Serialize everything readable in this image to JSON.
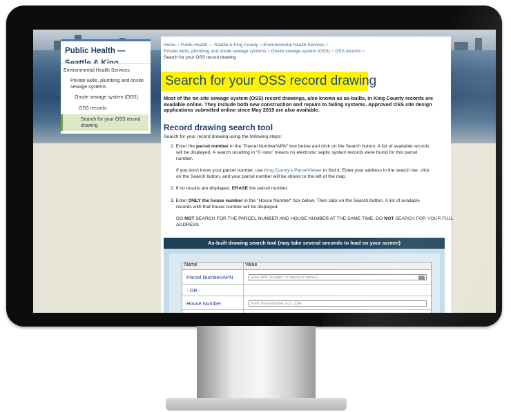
{
  "sidebar": {
    "title": "Public Health — Seattle & King County",
    "items": [
      "Environmental Health Services",
      "Private wells, plumbing and onsite sewage systems",
      "Onsite sewage system (OSS)",
      "OSS records",
      "Search for your OSS record drawing"
    ]
  },
  "breadcrumb": {
    "home": "Home",
    "b1": "Public Health — Seattle & King County",
    "b2": "Environmental Health Services",
    "b3": "Private wells, plumbing and onsite sewage systems",
    "b4": "Onsite sewage system (OSS)",
    "b5": "OSS records",
    "sep": ">",
    "current": "Search for your OSS record drawing"
  },
  "page": {
    "title": "Search for your OSS record drawing",
    "intro": "Most of the on-site sewage system (OSS) record drawings, also known as as-builts, in King County records are available online. They include both new construction and repairs to failing systems. Approved OSS site design applications submitted online since May 2019 are also available.",
    "section_title": "Record drawing search tool",
    "steps_intro": "Search for your record drawing using the following steps:",
    "step1_a": "1. Enter the ",
    "step1_b": "parcel number",
    "step1_c": " in the \"Parcel Number/APN\" box below and click on the Search button. A list of available records",
    "step1_d": "will be displayed. A search resulting in \"0 rows\" means no electronic septic system records were found for this parcel",
    "step1_e": "number.",
    "step1_help_a": "If you don't know your parcel number, use ",
    "step1_help_link": "King County's ParcelViewer",
    "step1_help_b": " to find it. Enter your address in the search bar, click",
    "step1_help_c": "on the Search button, and your parcel number will be shown to the left of the map.",
    "step2_a": "2. If no results are displayed, ",
    "step2_b": "ERASE",
    "step2_c": " the parcel number.",
    "step3_a": "3. Enter ",
    "step3_b": "ONLY the house number",
    "step3_c": " in the \"House Number\" box below. Then click on the Search button. A list of available",
    "step3_d": "records with that house number will be displayed.",
    "warn_a": "DO ",
    "warn_b": "NOT",
    "warn_c": " SEARCH FOR THE PARCEL NUMBER AND HOUSE NUMBER AT THE SAME TIME. DO ",
    "warn_d": "NOT",
    "warn_e": " SEARCH FOR YOUR FULL",
    "warn_f": "ADDRESS."
  },
  "tool": {
    "header": "As-built drawing search tool (may take several seconds to load on your screen)",
    "col_name": "Name",
    "col_value": "Value",
    "parcel_label": "Parcel Number/APN",
    "parcel_placeholder": "Enter APN (10-digits, no spaces or dashes)",
    "or_label": "- OR -",
    "house_label": "House Number",
    "house_placeholder": "Enter House Number (e.g. 1234)"
  },
  "colors": {
    "title_highlight": "#fff200",
    "heading": "#1d3a6a",
    "link": "#2d6aa0",
    "tool_header": "#1d4057"
  }
}
